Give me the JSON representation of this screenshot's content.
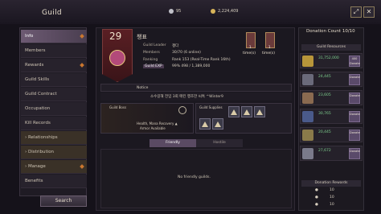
{
  "header": {
    "title": "Guild",
    "currencies": [
      {
        "icon": "silver-coin-icon",
        "value": "95"
      },
      {
        "icon": "gold-coin-icon",
        "value": "2,224,409"
      }
    ],
    "buttons": {
      "resize": "⤢",
      "close": "✕"
    }
  },
  "sidebar": {
    "items": [
      {
        "label": "Info",
        "active": true
      },
      {
        "label": "Members"
      },
      {
        "label": "Rewards"
      },
      {
        "label": "Guild Skills"
      },
      {
        "label": "Guild Contract"
      },
      {
        "label": "Occupation"
      },
      {
        "label": "Kill Records"
      },
      {
        "label": "Relationships",
        "group": true
      },
      {
        "label": "Distribution",
        "group": true
      },
      {
        "label": "Manage",
        "group": true
      },
      {
        "label": "Benefits"
      }
    ],
    "search_label": "Search"
  },
  "guild": {
    "level": "29",
    "name": "챙표",
    "rows": [
      {
        "label": "Guild Leader",
        "value": "챙다"
      },
      {
        "label": "Members",
        "value": "30/70 (6 online)"
      },
      {
        "label": "Ranking",
        "value": "Rank 153 (Real-Time Rank 16th)"
      },
      {
        "label": "Guild EXP",
        "value": "99% 498 / 1,389,000"
      }
    ],
    "exp_progress": 0.02,
    "buffs": [
      {
        "label": "time(s)",
        "count": "1"
      },
      {
        "label": "time(s)",
        "count": "1"
      }
    ]
  },
  "notice": {
    "label": "Notice",
    "chat": "소수길해 전임 3회 매킨 행조한 씨톡 ^Winter9"
  },
  "guild_boss": {
    "label": "Guild Boss",
    "desc_line1": "Health, Mana Recovery ▲",
    "desc_line2": "Armor Available"
  },
  "guild_supplies": {
    "label": "Guild Supplies",
    "slots": 5
  },
  "tabs": [
    {
      "label": "Friendly",
      "active": true
    },
    {
      "label": "Hostile"
    }
  ],
  "list_empty": "No friendly guilds.",
  "donation": {
    "title": "Donation Count",
    "count": "10/10",
    "resources_label": "Guild Resources",
    "items": [
      {
        "value": "31,752,000",
        "btn": "400 Donate",
        "color": "#b8963a"
      },
      {
        "value": "24,445",
        "btn": "Donate",
        "color": "#6a6a7a"
      },
      {
        "value": "23,605",
        "btn": "Donate",
        "color": "#8a6a50"
      },
      {
        "value": "30,765",
        "btn": "Donate",
        "color": "#4a5a8a"
      },
      {
        "value": "20,445",
        "btn": "Donate",
        "color": "#8a7a4a"
      },
      {
        "value": "27,672",
        "btn": "Donate",
        "color": "#7a7a8a"
      }
    ],
    "rewards_label": "Donation Rewards",
    "rewards": [
      {
        "value": "10"
      },
      {
        "value": "10"
      },
      {
        "value": "10"
      }
    ]
  }
}
